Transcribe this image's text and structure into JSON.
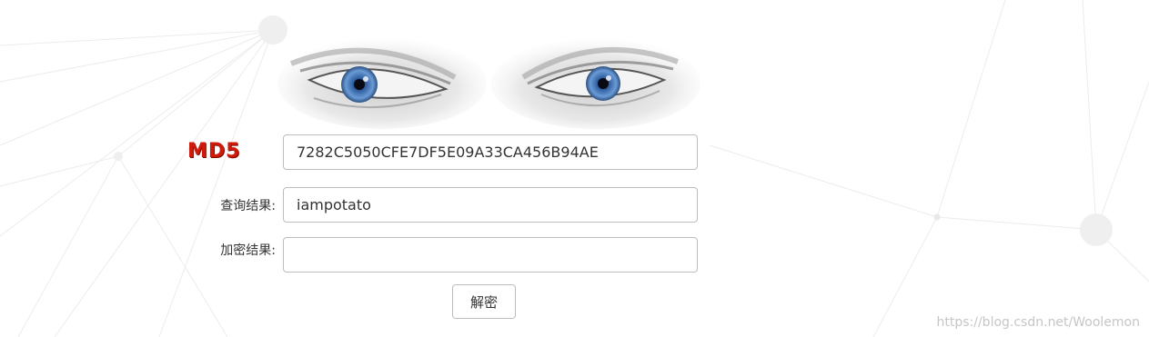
{
  "logo": {
    "text": "MD5"
  },
  "md5_input": {
    "value": "7282C5050CFE7DF5E09A33CA456B94AE"
  },
  "query_result": {
    "label": "查询结果:",
    "value": "iampotato"
  },
  "encrypt_result": {
    "label": "加密结果:",
    "value": ""
  },
  "decrypt_button": {
    "label": "解密"
  },
  "watermark": {
    "text": "https://blog.csdn.net/Woolemon"
  },
  "colors": {
    "logo_red": "#d01a0a",
    "border": "#bdbdbd",
    "text": "#333333",
    "eye_blue": "#4a7fc0",
    "watermark": "#c6c6c6"
  },
  "icons": [
    "eyes-banner-image",
    "network-lines-decoration"
  ]
}
